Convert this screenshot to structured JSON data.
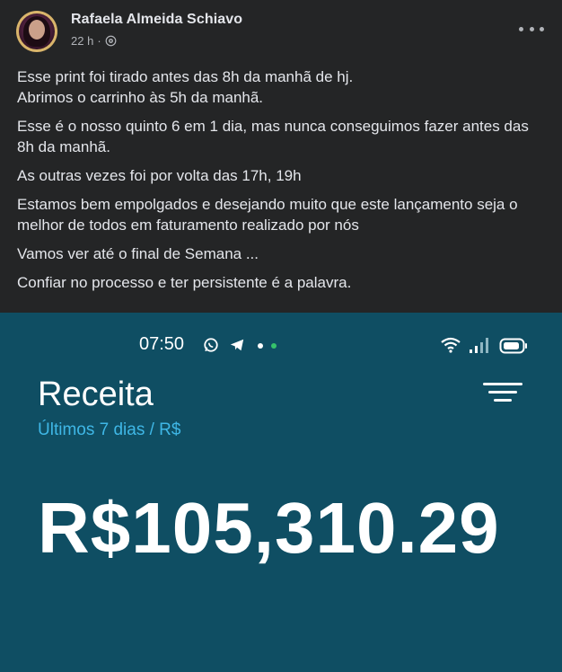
{
  "post": {
    "author_name": "Rafaela Almeida Schiavo",
    "time_ago": "22 h",
    "dot": "·",
    "privacy_icon": "globe-icon",
    "more_icon": "more-horizontal-icon",
    "paragraphs": [
      "Esse print foi tirado antes das 8h da manhã de hj.",
      "Abrimos o carrinho às 5h da manhã.",
      "Esse é o nosso quinto 6 em 1 dia, mas nunca conseguimos fazer antes das 8h da manhã.",
      "As outras vezes foi por volta das 17h, 19h",
      "Estamos bem empolgados e desejando muito que este lançamento seja o melhor de todos em faturamento realizado por nós",
      "Vamos ver até o final de Semana ...",
      "Confiar no processo e ter persistente é a palavra."
    ]
  },
  "screenshot": {
    "background_color": "#0f4e63",
    "status_bar": {
      "time": "07:50",
      "icons": [
        "whatsapp-icon",
        "telegram-icon",
        "wifi-icon",
        "signal-icon",
        "battery-icon"
      ]
    },
    "title": "Receita",
    "subtitle": "Últimos 7 dias / R$",
    "amount": "R$105,310.29",
    "accent_color": "#3fb7e6"
  },
  "colors": {
    "post_background": "#242526",
    "primary_text": "#e4e6eb",
    "secondary_text": "#b0b3b8"
  }
}
